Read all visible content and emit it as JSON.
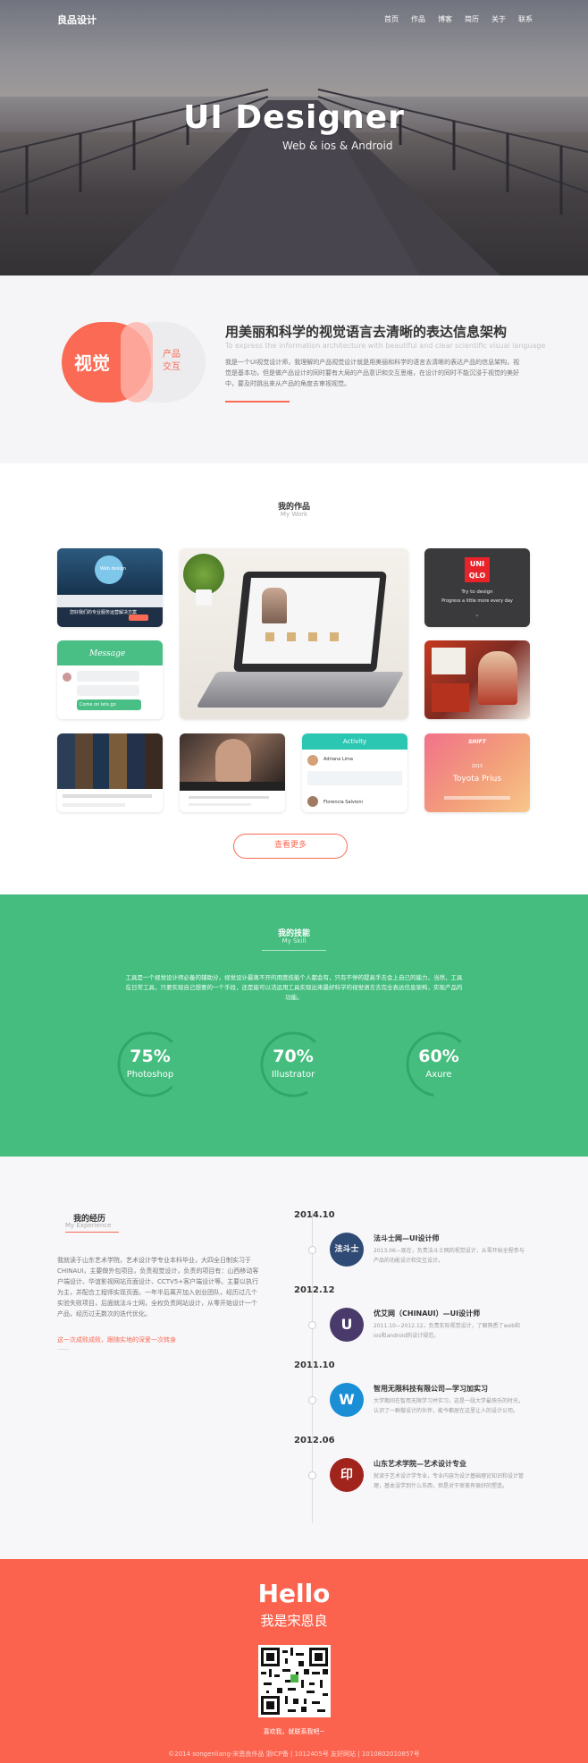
{
  "brand": {
    "logo": "良品设计"
  },
  "nav": [
    "首页",
    "作品",
    "博客",
    "简历",
    "关于",
    "联系"
  ],
  "hero": {
    "title": "UI Designer",
    "subtitle": "Web & ios & Android"
  },
  "intro": {
    "pill_main": "视觉",
    "pill_side_1": "产品",
    "pill_side_2": "交互",
    "heading": "用美丽和科学的视觉语言去清晰的表达信息架构",
    "subheading": "To express the information architecture with beautiful and clear scientific visual language",
    "description": "我是一个UI视觉设计师，我理解的产品视觉设计就是用美丽和科学的语言去清晰的表达产品的信息架构，视觉是基本功，但是做产品设计的同时要有大局的产品意识和交互思维，在设计的同时不能沉浸于视觉的美好中，要及时跳出来从产品的角度去审视视觉。"
  },
  "works": {
    "title": "我的作品",
    "subtitle": "My Work",
    "items": [
      {
        "label": "Web design",
        "text": "您好我们的专业服务运营解决方案"
      },
      {
        "label": "Message",
        "text": "Come on lets go"
      },
      {
        "label": "laptop",
        "text": ""
      },
      {
        "label": "UNIQLO",
        "text": "Try to design",
        "text2": "Progress a little more every day"
      },
      {
        "label": "sports",
        "text": ""
      },
      {
        "label": "city",
        "text": ""
      },
      {
        "label": "portrait",
        "text": ""
      },
      {
        "label": "Activity",
        "text": "Adriana Lima",
        "text2": "Florencia Salvioni"
      },
      {
        "label": "SHIFT",
        "text": "2015",
        "text2": "Toyota Prius"
      }
    ],
    "more_button": "查看更多"
  },
  "skills": {
    "title": "我的技能",
    "subtitle": "My Skill",
    "description": "工具是一个视觉设计师必备的辅助分，视觉设计最离不开的用度技能个人都会有，只有不停的提高手去会上自己的能力，当然，工具在日常工具，只要实现自己想要的一个手段，还是能可以活运用工具实现出来最好科学的视觉语言去完全表达信息架构，实现产品的功能。",
    "items": [
      {
        "percent": "75%",
        "name": "Photoshop",
        "value": 0.75
      },
      {
        "percent": "70%",
        "name": "Illustrator",
        "value": 0.7
      },
      {
        "percent": "60%",
        "name": "Axure",
        "value": 0.6
      }
    ]
  },
  "experience": {
    "title": "我的经历",
    "subtitle": "My Experience",
    "intro": "我就读于山东艺术学院，艺术设计学专业本科毕业，大四全日制实习于CHINAUI，主要做外包项目，负责视觉设计，负责的项目有：山西移动客户端设计、华谊影视网站页面设计、CCTV5+客户端设计等。主要以执行为主，并配合工程师实现页面。一年半后离开加入创业团队，经历过几个实验失败项目，后面就法斗士网，全权负责网站设计，从零开始设计一个产品，经历过无数次的迭代优化。",
    "highlight": "这一次成败成败，跟随实地的深爱一次转身",
    "dots": "......",
    "timeline": [
      {
        "year": "2014.10",
        "company": "法斗士网—UI设计师",
        "desc": "2013.06—现在，负责法斗士网的视觉设计，从零开始全程参与产品的功能设计和交互设计。",
        "color": "#2f4a74",
        "icon": "法斗士"
      },
      {
        "year": "2012.12",
        "company": "优艾网（CHINAUI）—UI设计师",
        "desc": "2011.10—2012.12，负责实际视觉设计，了解熟悉了web和ios和android的设计规范。",
        "color": "#4a3a6b",
        "icon": "U"
      },
      {
        "year": "2011.10",
        "company": "智用无限科技有限公司—学习加实习",
        "desc": "大学期间在智用无限学习并实习，这是一段大学最快乐的时光，认识了一群做设计的伙伴，能今都居在这里让人的设计公司。",
        "color": "#1a8fd6",
        "icon": "W"
      },
      {
        "year": "2012.06",
        "company": "山东艺术学院—艺术设计专业",
        "desc": "就读于艺术设计学专业，专业内容为设计基础理论知识和设计管理，基本没学到什么东西，但是对于审美有很好的塑造。",
        "color": "#a0231c",
        "icon": "印"
      }
    ]
  },
  "footer": {
    "hello": "Hello",
    "name": "我是宋恩良",
    "scan": "喜欢我，就联系我吧~",
    "copyright": "©2014 songenliang-宋恩良作品 浙ICP备 | 1012405号  友好网站 | 1010802010857号"
  }
}
